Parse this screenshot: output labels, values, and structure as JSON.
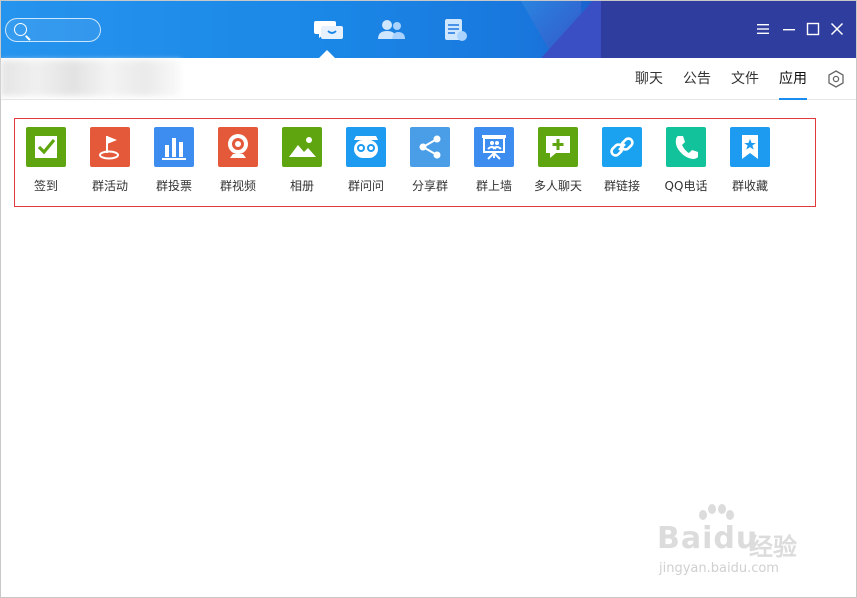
{
  "header": {
    "search_placeholder": "",
    "top_tabs": [
      {
        "name": "chat-icon",
        "active": true
      },
      {
        "name": "members-icon",
        "active": false
      },
      {
        "name": "notes-icon",
        "active": false
      }
    ]
  },
  "subnav": {
    "tabs": [
      {
        "label": "聊天"
      },
      {
        "label": "公告"
      },
      {
        "label": "文件"
      },
      {
        "label": "应用"
      }
    ],
    "active_tab": "应用"
  },
  "apps": [
    {
      "label": "签到",
      "icon": "checkin-icon",
      "color": "#5fa50f"
    },
    {
      "label": "群活动",
      "icon": "flag-icon",
      "color": "#e4593a"
    },
    {
      "label": "群投票",
      "icon": "bar-chart-icon",
      "color": "#3d8df0"
    },
    {
      "label": "群视频",
      "icon": "webcam-icon",
      "color": "#e4593a"
    },
    {
      "label": "相册",
      "icon": "photo-icon",
      "color": "#5fa50f"
    },
    {
      "label": "群问问",
      "icon": "owl-icon",
      "color": "#1c9bf0"
    },
    {
      "label": "分享群",
      "icon": "share-icon",
      "color": "#4a9ee8"
    },
    {
      "label": "群上墙",
      "icon": "presentation-icon",
      "color": "#3d8df0"
    },
    {
      "label": "多人聊天",
      "icon": "chat-plus-icon",
      "color": "#5fa50f"
    },
    {
      "label": "群链接",
      "icon": "link-icon",
      "color": "#1aa2f0"
    },
    {
      "label": "QQ电话",
      "icon": "phone-icon",
      "color": "#12c29a"
    },
    {
      "label": "群收藏",
      "icon": "bookmark-icon",
      "color": "#1c9bf0"
    }
  ],
  "watermark": {
    "logo": "Baidu",
    "cn": "经验",
    "url": "jingyan.baidu.com"
  }
}
